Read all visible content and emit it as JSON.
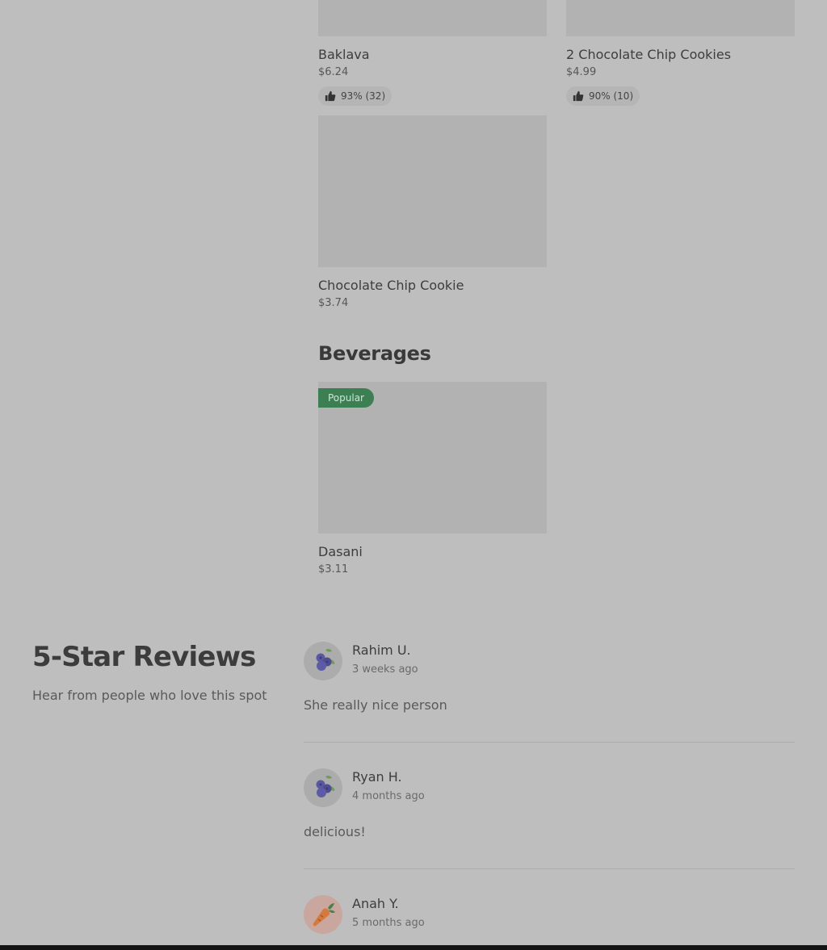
{
  "menu": {
    "desserts": [
      {
        "name": "Baklava",
        "price": "$6.24",
        "rating": "93% (32)"
      },
      {
        "name": "2 Chocolate Chip Cookies",
        "price": "$4.99",
        "rating": "90% (10)"
      },
      {
        "name": "Chocolate Chip Cookie",
        "price": "$3.74"
      }
    ],
    "beverages_title": "Beverages",
    "beverages": [
      {
        "name": "Dasani",
        "price": "$3.11",
        "badge": "Popular"
      }
    ]
  },
  "reviews": {
    "heading": "5-Star Reviews",
    "subheading": "Hear from people who love this spot",
    "items": [
      {
        "author": "Rahim U.",
        "when": "3 weeks ago",
        "text": "She really nice person",
        "avatar_icon": "blueberry-icon"
      },
      {
        "author": "Ryan H.",
        "when": "4 months ago",
        "text": "delicious!",
        "avatar_icon": "blueberry-icon"
      },
      {
        "author": "Anah Y.",
        "when": "5 months ago",
        "avatar_icon": "carrot-icon"
      }
    ]
  },
  "colors": {
    "background": "#bebebe",
    "image_placeholder": "#b2b2b2",
    "badge": "#3b7f52"
  }
}
